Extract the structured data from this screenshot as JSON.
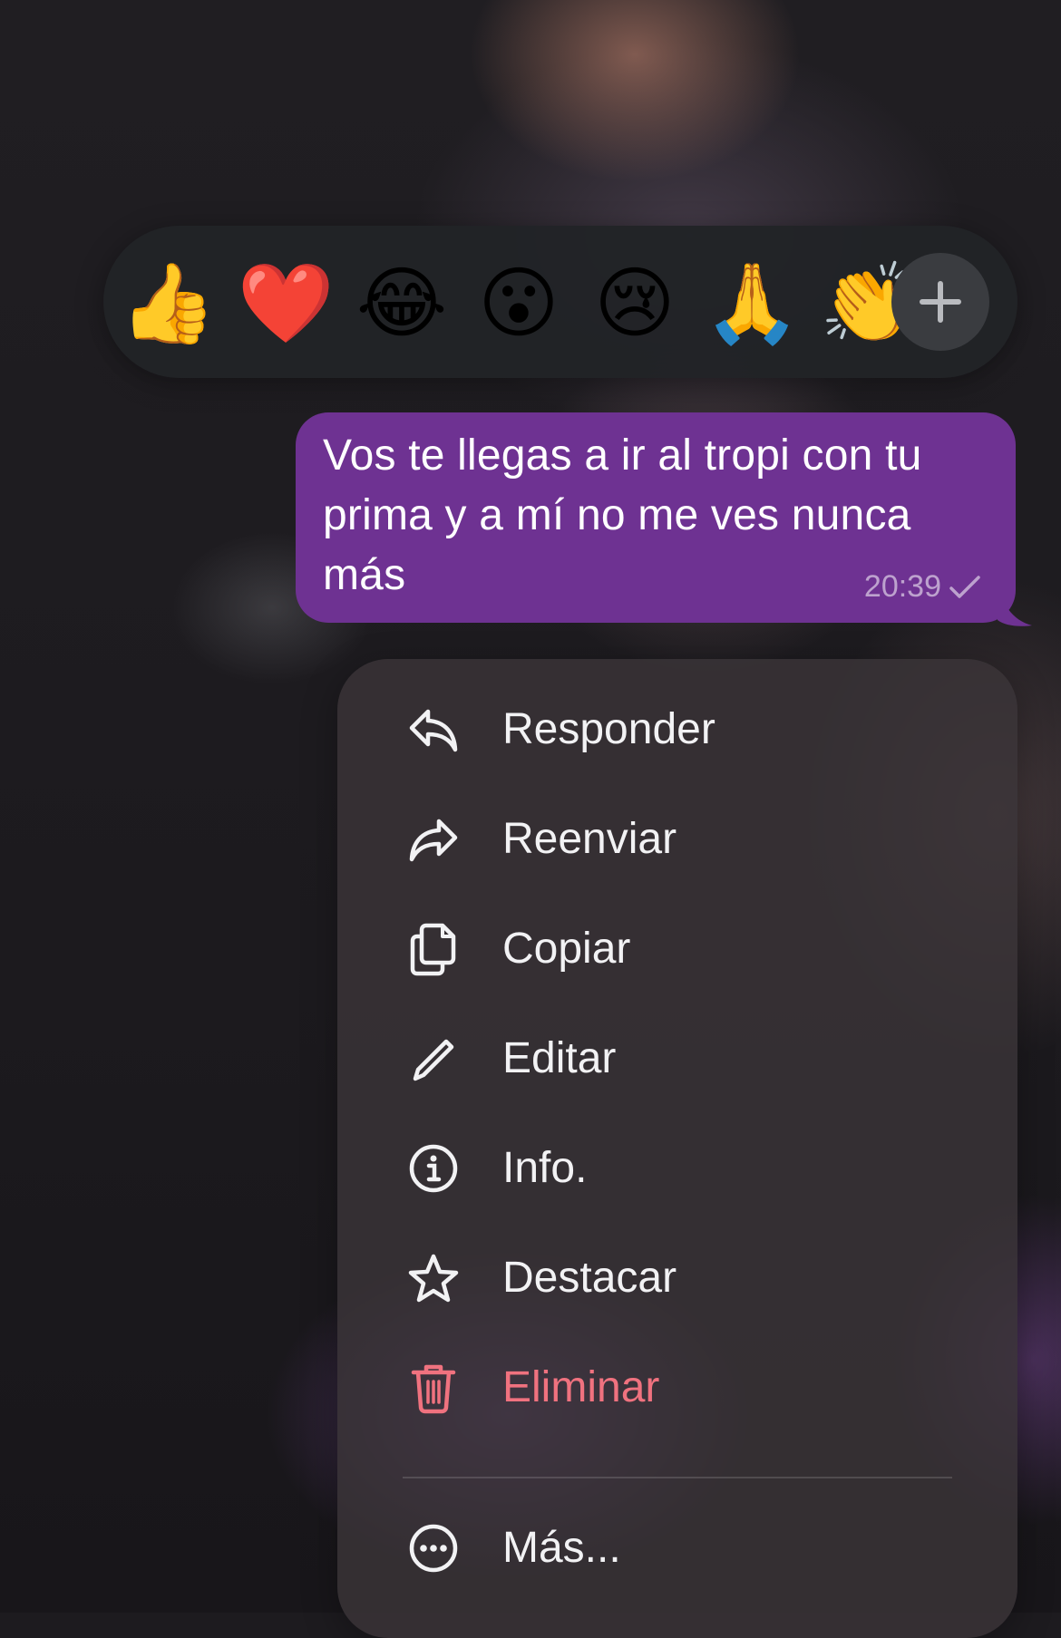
{
  "reactions": {
    "emojis": [
      {
        "name": "thumbs-up",
        "glyph": "👍"
      },
      {
        "name": "heart",
        "glyph": "❤️"
      },
      {
        "name": "tears-of-joy",
        "glyph": "😂"
      },
      {
        "name": "surprised",
        "glyph": "😮"
      },
      {
        "name": "crying",
        "glyph": "😢"
      },
      {
        "name": "folded-hands",
        "glyph": "🙏"
      },
      {
        "name": "clapping",
        "glyph": "👏"
      }
    ],
    "add_icon": "plus-icon"
  },
  "message": {
    "text": "Vos te llegas a ir al tropi con tu prima y a mí no me ves nunca más",
    "time": "20:39",
    "status_icon": "check-icon",
    "bubble_color": "#6e3292"
  },
  "menu": {
    "items": [
      {
        "label": "Responder",
        "icon": "reply-icon"
      },
      {
        "label": "Reenviar",
        "icon": "forward-icon"
      },
      {
        "label": "Copiar",
        "icon": "copy-icon"
      },
      {
        "label": "Editar",
        "icon": "pencil-icon"
      },
      {
        "label": "Info.",
        "icon": "info-icon"
      },
      {
        "label": "Destacar",
        "icon": "star-icon"
      },
      {
        "label": "Eliminar",
        "icon": "trash-icon",
        "color": "#f0727f"
      },
      {
        "label": "Más...",
        "icon": "more-icon"
      }
    ]
  }
}
